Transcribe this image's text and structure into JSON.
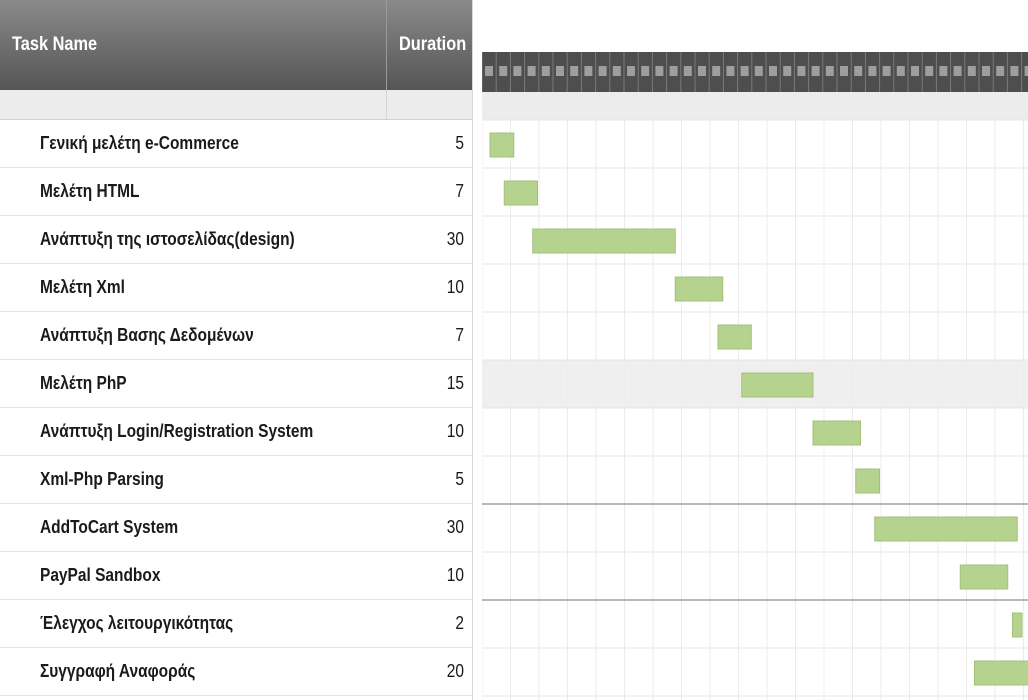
{
  "header": {
    "task_name": "Task Name",
    "duration": "Duration"
  },
  "tasks": [
    {
      "name": "Γενική μελέτη e-Commerce",
      "duration": "5"
    },
    {
      "name": "Μελέτη HTML",
      "duration": "7"
    },
    {
      "name": "Ανάπτυξη της ιστοσελίδας(design)",
      "duration": "30"
    },
    {
      "name": "Μελέτη Xml",
      "duration": "10"
    },
    {
      "name": "Ανάπτυξη Βασης Δεδομένων",
      "duration": "7"
    },
    {
      "name": "Μελέτη PhP",
      "duration": "15"
    },
    {
      "name": "Ανάπτυξη Login/Registration System",
      "duration": "10"
    },
    {
      "name": "Xml-Php Parsing",
      "duration": "5"
    },
    {
      "name": "AddToCart System",
      "duration": "30"
    },
    {
      "name": "PayPal Sandbox",
      "duration": "10"
    },
    {
      "name": "Έλεγχος λειτουργικότητας",
      "duration": "2"
    },
    {
      "name": "Συγγραφή Αναφοράς",
      "duration": "20"
    }
  ],
  "gantt": {
    "bar_color": "#b5d28f",
    "bar_border": "#a3c07b",
    "bars_days": [
      {
        "start": 0,
        "length": 5
      },
      {
        "start": 3,
        "length": 7
      },
      {
        "start": 9,
        "length": 30
      },
      {
        "start": 39,
        "length": 10
      },
      {
        "start": 48,
        "length": 7
      },
      {
        "start": 53,
        "length": 15
      },
      {
        "start": 68,
        "length": 10
      },
      {
        "start": 77,
        "length": 5
      },
      {
        "start": 81,
        "length": 30
      },
      {
        "start": 99,
        "length": 10
      },
      {
        "start": 110,
        "length": 2
      },
      {
        "start": 102,
        "length": 20
      }
    ],
    "highlighted_row": 5
  }
}
